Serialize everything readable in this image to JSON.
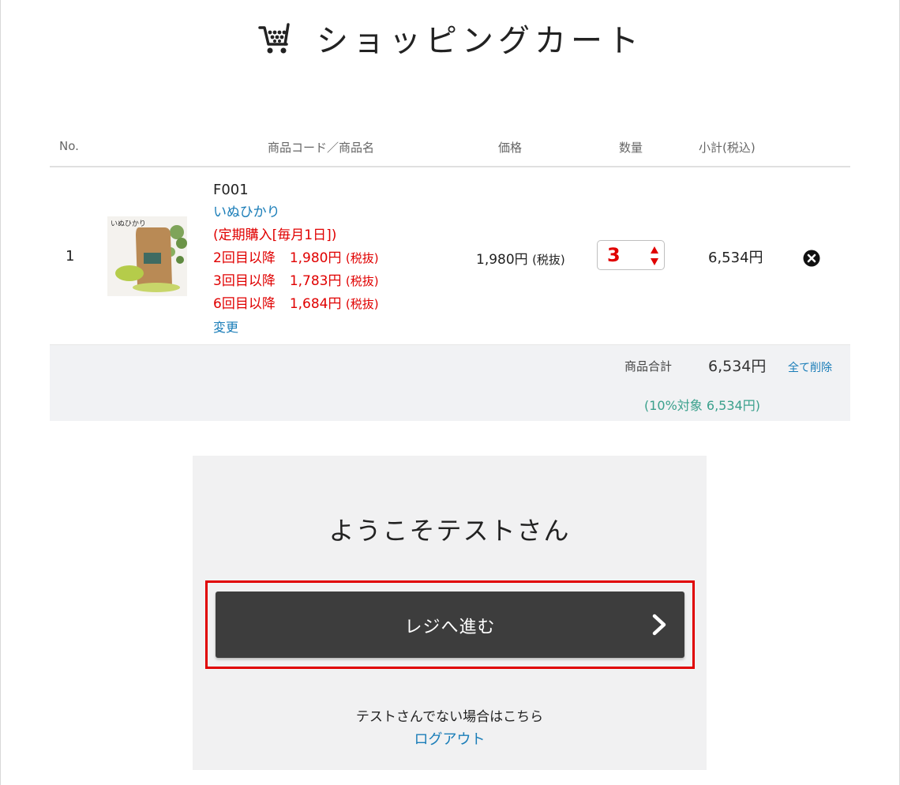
{
  "header": {
    "title": "ショッピングカート",
    "icon": "shopping-cart-icon"
  },
  "table": {
    "headers": {
      "no": "No.",
      "product": "商品コード／商品名",
      "price": "価格",
      "quantity": "数量",
      "subtotal": "小計(税込)"
    },
    "rows": [
      {
        "no": "1",
        "image_label": "いぬひかり",
        "code": "F001",
        "name": "いぬひかり",
        "subscription": "(定期購入[毎月1日])",
        "tiers": [
          {
            "label": "2回目以降",
            "price": "1,980円",
            "tax": "(税抜)"
          },
          {
            "label": "3回目以降",
            "price": "1,783円",
            "tax": "(税抜)"
          },
          {
            "label": "6回目以降",
            "price": "1,684円",
            "tax": "(税抜)"
          }
        ],
        "change_label": "変更",
        "unit_price": "1,980円",
        "unit_price_tax": "(税抜)",
        "quantity": "3",
        "subtotal": "6,534円"
      }
    ]
  },
  "summary": {
    "label": "商品合計",
    "total": "6,534円",
    "delete_all": "全て削除",
    "tax_note": "(10%対象 6,534円)"
  },
  "login": {
    "welcome": "ようこそテストさん",
    "checkout_label": "レジへ進む",
    "not_user_text": "テストさんでない場合はこちら",
    "logout_label": "ログアウト"
  },
  "colors": {
    "accent_red": "#e00000",
    "link_blue": "#1a7db8",
    "tax_green": "#3aa08c",
    "button_dark": "#3d3d3d"
  }
}
